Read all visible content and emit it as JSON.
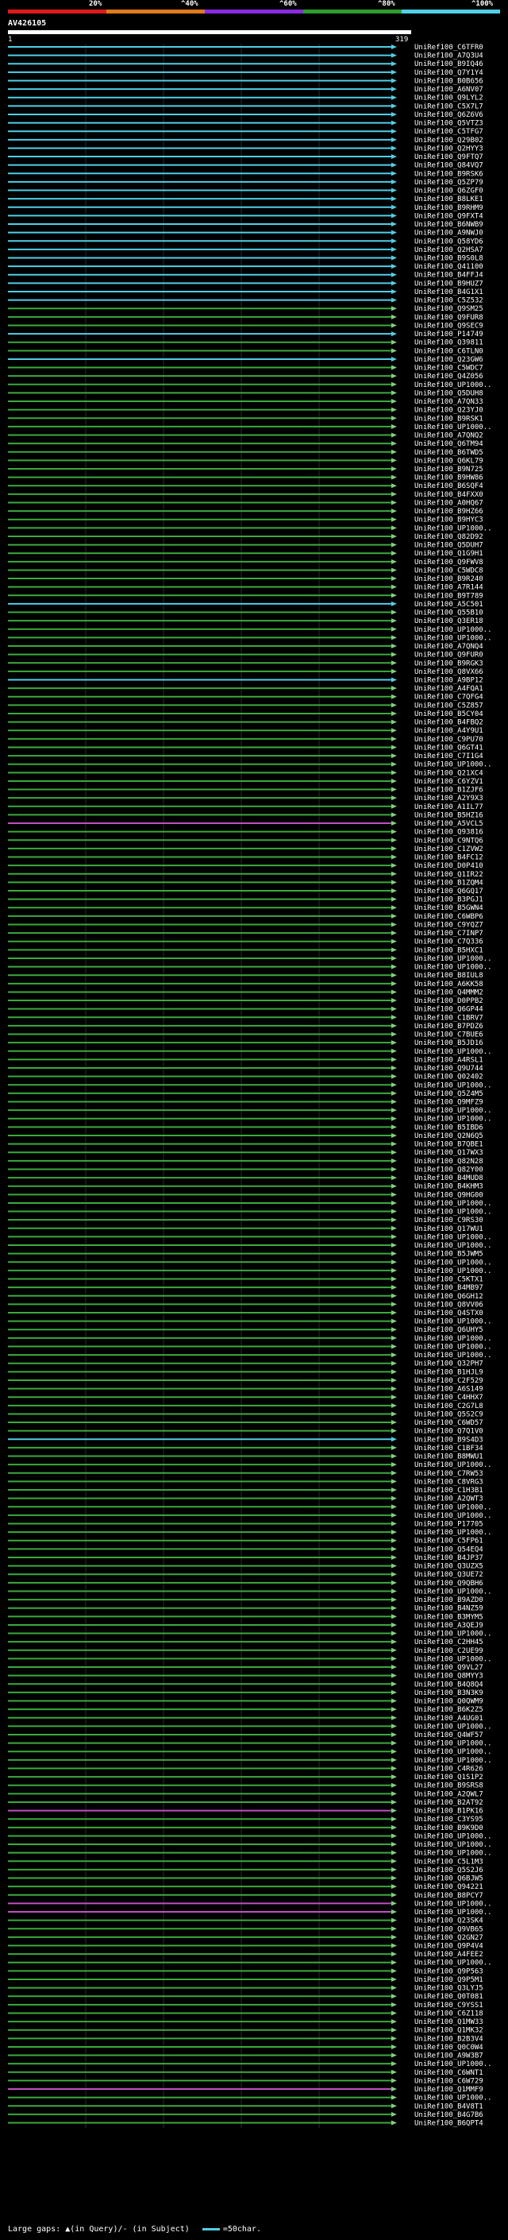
{
  "query": {
    "id": "AV426105",
    "start": "1",
    "end": "319"
  },
  "scale": {
    "labels": [
      "20%",
      "^40%",
      "^60%",
      "^80%",
      "^100%"
    ],
    "colors": [
      "#e01a1a",
      "#e07a1a",
      "#8a2be2",
      "#2e9e2e",
      "#4fd0e6"
    ]
  },
  "colors": {
    "cyan": "#4fd0e6",
    "green": "#3caa3c",
    "magenta": "#c050c0",
    "arrow": "#7fd07f",
    "gap": "#ffff66",
    "grid": "#4a4a4a"
  },
  "hits": [
    {
      "label": "UniRef100_C6TFR0",
      "color": "cyan"
    },
    {
      "label": "UniRef100_A7Q3U4",
      "color": "cyan"
    },
    {
      "label": "UniRef100_B9IQ46",
      "color": "cyan"
    },
    {
      "label": "UniRef100_Q7Y1Y4",
      "color": "cyan"
    },
    {
      "label": "UniRef100_B0B656",
      "color": "cyan"
    },
    {
      "label": "UniRef100_A6NV07",
      "color": "cyan"
    },
    {
      "label": "UniRef100_Q9LYL2",
      "color": "cyan"
    },
    {
      "label": "UniRef100_C5X7L7",
      "color": "cyan"
    },
    {
      "label": "UniRef100_Q6Z6V6",
      "color": "cyan"
    },
    {
      "label": "UniRef100_Q5VTZ3",
      "color": "cyan"
    },
    {
      "label": "UniRef100_C5TFG7",
      "color": "cyan"
    },
    {
      "label": "UniRef100_Q29B02",
      "color": "cyan"
    },
    {
      "label": "UniRef100_Q2HYY3",
      "color": "cyan"
    },
    {
      "label": "UniRef100_Q9FTQ7",
      "color": "cyan"
    },
    {
      "label": "UniRef100_Q84VQ7",
      "color": "cyan"
    },
    {
      "label": "UniRef100_B9RSK6",
      "color": "cyan"
    },
    {
      "label": "UniRef100_Q5ZP79",
      "color": "cyan"
    },
    {
      "label": "UniRef100_Q6ZGF0",
      "color": "cyan"
    },
    {
      "label": "UniRef100_B8LKE1",
      "color": "cyan"
    },
    {
      "label": "UniRef100_B9RHM9",
      "color": "cyan"
    },
    {
      "label": "UniRef100_Q9FXT4",
      "color": "cyan"
    },
    {
      "label": "UniRef100_B6NWB9",
      "color": "cyan"
    },
    {
      "label": "UniRef100_A9NWJ0",
      "color": "cyan"
    },
    {
      "label": "UniRef100_Q58YD6",
      "color": "cyan"
    },
    {
      "label": "UniRef100_Q2HSA7",
      "color": "cyan"
    },
    {
      "label": "UniRef100_B9S0L8",
      "color": "cyan"
    },
    {
      "label": "UniRef100_Q41100",
      "color": "cyan"
    },
    {
      "label": "UniRef100_B4FFJ4",
      "color": "cyan"
    },
    {
      "label": "UniRef100_B9HUZ7",
      "color": "cyan"
    },
    {
      "label": "UniRef100_B4G1X1",
      "color": "cyan"
    },
    {
      "label": "UniRef100_C5Z532",
      "color": "cyan"
    },
    {
      "label": "UniRef100_Q9SM25",
      "color": "green"
    },
    {
      "label": "UniRef100_Q9FUR8",
      "color": "green"
    },
    {
      "label": "UniRef100_Q9SEC9",
      "color": "green"
    },
    {
      "label": "UniRef100_P14749",
      "color": "cyan"
    },
    {
      "label": "UniRef100_Q39811",
      "color": "green"
    },
    {
      "label": "UniRef100_C6TLN0",
      "color": "green"
    },
    {
      "label": "UniRef100_Q23GW6",
      "color": "cyan"
    },
    {
      "label": "UniRef100_C5WDC7",
      "color": "green"
    },
    {
      "label": "UniRef100_Q4Z056",
      "color": "green"
    },
    {
      "label": "UniRef100_UP1000..",
      "color": "green"
    },
    {
      "label": "UniRef100_Q5DUH8",
      "color": "green"
    },
    {
      "label": "UniRef100_A7QN33",
      "color": "green"
    },
    {
      "label": "UniRef100_Q23YJ0",
      "color": "green"
    },
    {
      "label": "UniRef100_B9RSK1",
      "color": "green"
    },
    {
      "label": "UniRef100_UP1000..",
      "color": "green"
    },
    {
      "label": "UniRef100_A7QNQ2",
      "color": "green"
    },
    {
      "label": "UniRef100_Q6TM94",
      "color": "green"
    },
    {
      "label": "UniRef100_B6TWD5",
      "color": "green"
    },
    {
      "label": "UniRef100_Q6KL79",
      "color": "green"
    },
    {
      "label": "UniRef100_B9N725",
      "color": "green"
    },
    {
      "label": "UniRef100_B9HW86",
      "color": "green"
    },
    {
      "label": "UniRef100_B6SQF4",
      "color": "green"
    },
    {
      "label": "UniRef100_B4FXX0",
      "color": "green"
    },
    {
      "label": "UniRef100_A0HQ67",
      "color": "green"
    },
    {
      "label": "UniRef100_B9HZ66",
      "color": "green"
    },
    {
      "label": "UniRef100_B9HYC3",
      "color": "green"
    },
    {
      "label": "UniRef100_UP1000..",
      "color": "green"
    },
    {
      "label": "UniRef100_Q82D92",
      "color": "green"
    },
    {
      "label": "UniRef100_Q5DUH7",
      "color": "green"
    },
    {
      "label": "UniRef100_Q1G9H1",
      "color": "green"
    },
    {
      "label": "UniRef100_Q9FWV8",
      "color": "green"
    },
    {
      "label": "UniRef100_C5WDC8",
      "color": "green"
    },
    {
      "label": "UniRef100_B9R240",
      "color": "green"
    },
    {
      "label": "UniRef100_A7R144",
      "color": "green"
    },
    {
      "label": "UniRef100_B9T789",
      "color": "green"
    },
    {
      "label": "UniRef100_A5C501",
      "color": "cyan"
    },
    {
      "label": "UniRef100_Q55B10",
      "color": "green"
    },
    {
      "label": "UniRef100_Q3ER18",
      "color": "green"
    },
    {
      "label": "UniRef100_UP1000..",
      "color": "green"
    },
    {
      "label": "UniRef100_UP1000..",
      "color": "green"
    },
    {
      "label": "UniRef100_A7QNQ4",
      "color": "green"
    },
    {
      "label": "UniRef100_Q9FUR0",
      "color": "green"
    },
    {
      "label": "UniRef100_B9RGK3",
      "color": "green"
    },
    {
      "label": "UniRef100_Q8VX66",
      "color": "green"
    },
    {
      "label": "UniRef100_A9BP12",
      "color": "cyan"
    },
    {
      "label": "UniRef100_A4FQA1",
      "color": "green"
    },
    {
      "label": "UniRef100_C7QFG4",
      "color": "green"
    },
    {
      "label": "UniRef100_C5Z857",
      "color": "green"
    },
    {
      "label": "UniRef100_B5CY04",
      "color": "green"
    },
    {
      "label": "UniRef100_B4FBQ2",
      "color": "green"
    },
    {
      "label": "UniRef100_A4Y9U1",
      "color": "green"
    },
    {
      "label": "UniRef100_C9PU70",
      "color": "green"
    },
    {
      "label": "UniRef100_Q6GT41",
      "color": "green"
    },
    {
      "label": "UniRef100_C7I1G4",
      "color": "green"
    },
    {
      "label": "UniRef100_UP1000..",
      "color": "green"
    },
    {
      "label": "UniRef100_Q21XC4",
      "color": "green"
    },
    {
      "label": "UniRef100_C6YZV1",
      "color": "green"
    },
    {
      "label": "UniRef100_B1ZJF6",
      "color": "green"
    },
    {
      "label": "UniRef100_A2Y9X3",
      "color": "green"
    },
    {
      "label": "UniRef100_A1IL77",
      "color": "green"
    },
    {
      "label": "UniRef100_B5HZ16",
      "color": "green"
    },
    {
      "label": "UniRef100_A5VCL5",
      "color": "magenta"
    },
    {
      "label": "UniRef100_Q93816",
      "color": "green"
    },
    {
      "label": "UniRef100_C9NTQ6",
      "color": "green"
    },
    {
      "label": "UniRef100_C1ZVW2",
      "color": "green"
    },
    {
      "label": "UniRef100_B4FC12",
      "color": "green"
    },
    {
      "label": "UniRef100_D0P410",
      "color": "green"
    },
    {
      "label": "UniRef100_Q1IR22",
      "color": "green"
    },
    {
      "label": "UniRef100_B1ZQM4",
      "color": "green"
    },
    {
      "label": "UniRef100_Q6GQ17",
      "color": "green"
    },
    {
      "label": "UniRef100_B3PGJ1",
      "color": "green"
    },
    {
      "label": "UniRef100_B5GWN4",
      "color": "green"
    },
    {
      "label": "UniRef100_C6WBP6",
      "color": "green"
    },
    {
      "label": "UniRef100_C9YQZ7",
      "color": "green"
    },
    {
      "label": "UniRef100_C7INP7",
      "color": "green"
    },
    {
      "label": "UniRef100_C7Q336",
      "color": "green"
    },
    {
      "label": "UniRef100_B5HXC1",
      "color": "green"
    },
    {
      "label": "UniRef100_UP1000..",
      "color": "green"
    },
    {
      "label": "UniRef100_UP1000..",
      "color": "green"
    },
    {
      "label": "UniRef100_B8IUL8",
      "color": "green"
    },
    {
      "label": "UniRef100_A6KK58",
      "color": "green"
    },
    {
      "label": "UniRef100_Q4MMM2",
      "color": "green"
    },
    {
      "label": "UniRef100_D0PPB2",
      "color": "green"
    },
    {
      "label": "UniRef100_Q6GP44",
      "color": "green"
    },
    {
      "label": "UniRef100_C1BRV7",
      "color": "green"
    },
    {
      "label": "UniRef100_B7PDZ6",
      "color": "green"
    },
    {
      "label": "UniRef100_C7BUE6",
      "color": "green"
    },
    {
      "label": "UniRef100_B5JD16",
      "color": "green"
    },
    {
      "label": "UniRef100_UP1000..",
      "color": "green"
    },
    {
      "label": "UniRef100_A4RSL1",
      "color": "green"
    },
    {
      "label": "UniRef100_Q9U744",
      "color": "green"
    },
    {
      "label": "UniRef100_Q02402",
      "color": "green"
    },
    {
      "label": "UniRef100_UP1000..",
      "color": "green"
    },
    {
      "label": "UniRef100_Q5Z4M5",
      "color": "green"
    },
    {
      "label": "UniRef100_Q9MFZ9",
      "color": "green"
    },
    {
      "label": "UniRef100_UP1000..",
      "color": "green"
    },
    {
      "label": "UniRef100_UP1000..",
      "color": "green"
    },
    {
      "label": "UniRef100_B5IBD6",
      "color": "green"
    },
    {
      "label": "UniRef100_Q2N6Q5",
      "color": "green"
    },
    {
      "label": "UniRef100_B7QBE1",
      "color": "green"
    },
    {
      "label": "UniRef100_Q17WX3",
      "color": "green"
    },
    {
      "label": "UniRef100_Q82N28",
      "color": "green"
    },
    {
      "label": "UniRef100_Q82Y00",
      "color": "green"
    },
    {
      "label": "UniRef100_B4MUD8",
      "color": "green"
    },
    {
      "label": "UniRef100_B4KHM3",
      "color": "green"
    },
    {
      "label": "UniRef100_Q9HG00",
      "color": "green"
    },
    {
      "label": "UniRef100_UP1000..",
      "color": "green"
    },
    {
      "label": "UniRef100_UP1000..",
      "color": "green"
    },
    {
      "label": "UniRef100_C9RS30",
      "color": "green"
    },
    {
      "label": "UniRef100_Q17WU1",
      "color": "green"
    },
    {
      "label": "UniRef100_UP1000..",
      "color": "green"
    },
    {
      "label": "UniRef100_UP1000..",
      "color": "green"
    },
    {
      "label": "UniRef100_B5JWM5",
      "color": "green"
    },
    {
      "label": "UniRef100_UP1000..",
      "color": "green"
    },
    {
      "label": "UniRef100_UP1000..",
      "color": "green"
    },
    {
      "label": "UniRef100_C5KTX1",
      "color": "green"
    },
    {
      "label": "UniRef100_B4MB97",
      "color": "green"
    },
    {
      "label": "UniRef100_Q6GH12",
      "color": "green"
    },
    {
      "label": "UniRef100_Q8VV06",
      "color": "green"
    },
    {
      "label": "UniRef100_Q4STX0",
      "color": "green"
    },
    {
      "label": "UniRef100_UP1000..",
      "color": "green"
    },
    {
      "label": "UniRef100_Q6UHY5",
      "color": "green"
    },
    {
      "label": "UniRef100_UP1000..",
      "color": "green"
    },
    {
      "label": "UniRef100_UP1000..",
      "color": "green"
    },
    {
      "label": "UniRef100_UP1000..",
      "color": "green"
    },
    {
      "label": "UniRef100_Q32PH7",
      "color": "green"
    },
    {
      "label": "UniRef100_B1HJL9",
      "color": "green"
    },
    {
      "label": "UniRef100_C2F529",
      "color": "green"
    },
    {
      "label": "UniRef100_A6S149",
      "color": "green"
    },
    {
      "label": "UniRef100_C4HHX7",
      "color": "green"
    },
    {
      "label": "UniRef100_C2G7L8",
      "color": "green"
    },
    {
      "label": "UniRef100_Q5S2C9",
      "color": "green"
    },
    {
      "label": "UniRef100_C6WD57",
      "color": "green"
    },
    {
      "label": "UniRef100_Q7Q1V0",
      "color": "green"
    },
    {
      "label": "UniRef100_B9S4D3",
      "color": "cyan"
    },
    {
      "label": "UniRef100_C1BF34",
      "color": "green"
    },
    {
      "label": "UniRef100_B8MWU1",
      "color": "green"
    },
    {
      "label": "UniRef100_UP1000..",
      "color": "green"
    },
    {
      "label": "UniRef100_C7RW53",
      "color": "green"
    },
    {
      "label": "UniRef100_C8VRG3",
      "color": "green"
    },
    {
      "label": "UniRef100_C1H3B1",
      "color": "green"
    },
    {
      "label": "UniRef100_A2QWT3",
      "color": "green"
    },
    {
      "label": "UniRef100_UP1000..",
      "color": "green"
    },
    {
      "label": "UniRef100_UP1000..",
      "color": "green"
    },
    {
      "label": "UniRef100_P17705",
      "color": "green"
    },
    {
      "label": "UniRef100_UP1000..",
      "color": "green"
    },
    {
      "label": "UniRef100_C5FP61",
      "color": "green"
    },
    {
      "label": "UniRef100_Q54EQ4",
      "color": "green"
    },
    {
      "label": "UniRef100_B4JP37",
      "color": "green"
    },
    {
      "label": "UniRef100_Q3UZX5",
      "color": "green"
    },
    {
      "label": "UniRef100_Q3UE72",
      "color": "green"
    },
    {
      "label": "UniRef100_Q9QBH6",
      "color": "green"
    },
    {
      "label": "UniRef100_UP1000..",
      "color": "green"
    },
    {
      "label": "UniRef100_B9AZD0",
      "color": "green"
    },
    {
      "label": "UniRef100_B4NZ59",
      "color": "green"
    },
    {
      "label": "UniRef100_B3MYM5",
      "color": "green"
    },
    {
      "label": "UniRef100_A3QEJ9",
      "color": "green"
    },
    {
      "label": "UniRef100_UP1000..",
      "color": "green"
    },
    {
      "label": "UniRef100_C2HH45",
      "color": "green"
    },
    {
      "label": "UniRef100_C2UE99",
      "color": "green"
    },
    {
      "label": "UniRef100_UP1000..",
      "color": "green"
    },
    {
      "label": "UniRef100_Q9VL27",
      "color": "green"
    },
    {
      "label": "UniRef100_Q8MYY3",
      "color": "green"
    },
    {
      "label": "UniRef100_B4Q8Q4",
      "color": "green"
    },
    {
      "label": "UniRef100_B3N3K9",
      "color": "green"
    },
    {
      "label": "UniRef100_Q0QWM9",
      "color": "green"
    },
    {
      "label": "UniRef100_B6K2Z5",
      "color": "green"
    },
    {
      "label": "UniRef100_A4UG01",
      "color": "green"
    },
    {
      "label": "UniRef100_UP1000..",
      "color": "green"
    },
    {
      "label": "UniRef100_Q4WF57",
      "color": "green"
    },
    {
      "label": "UniRef100_UP1000..",
      "color": "green"
    },
    {
      "label": "UniRef100_UP1000..",
      "color": "green"
    },
    {
      "label": "UniRef100_UP1000..",
      "color": "green"
    },
    {
      "label": "UniRef100_C4R626",
      "color": "green"
    },
    {
      "label": "UniRef100_Q1S1P2",
      "color": "green"
    },
    {
      "label": "UniRef100_B9SRS8",
      "color": "green"
    },
    {
      "label": "UniRef100_A2QWL7",
      "color": "green"
    },
    {
      "label": "UniRef100_B2AT92",
      "color": "green"
    },
    {
      "label": "UniRef100_B1PK16",
      "color": "magenta"
    },
    {
      "label": "UniRef100_C3YS95",
      "color": "green"
    },
    {
      "label": "UniRef100_B9K9D0",
      "color": "green"
    },
    {
      "label": "UniRef100_UP1000..",
      "color": "green"
    },
    {
      "label": "UniRef100_UP1000..",
      "color": "green"
    },
    {
      "label": "UniRef100_UP1000..",
      "color": "green"
    },
    {
      "label": "UniRef100_C5L1M3",
      "color": "green"
    },
    {
      "label": "UniRef100_Q5S2J6",
      "color": "green"
    },
    {
      "label": "UniRef100_Q6BJW5",
      "color": "green"
    },
    {
      "label": "UniRef100_Q94221",
      "color": "green"
    },
    {
      "label": "UniRef100_B8PCY7",
      "color": "green"
    },
    {
      "label": "UniRef100_UP1000..",
      "color": "magenta"
    },
    {
      "label": "UniRef100_UP1000..",
      "color": "magenta"
    },
    {
      "label": "UniRef100_Q23SK4",
      "color": "green"
    },
    {
      "label": "UniRef100_Q9VB65",
      "color": "green"
    },
    {
      "label": "UniRef100_Q2GN27",
      "color": "green"
    },
    {
      "label": "UniRef100_Q9P4V4",
      "color": "green"
    },
    {
      "label": "UniRef100_A4FEE2",
      "color": "green"
    },
    {
      "label": "UniRef100_UP1000..",
      "color": "green"
    },
    {
      "label": "UniRef100_Q9P563",
      "color": "green"
    },
    {
      "label": "UniRef100_Q9P5M1",
      "color": "green"
    },
    {
      "label": "UniRef100_Q3LYJ5",
      "color": "green"
    },
    {
      "label": "UniRef100_Q0T081",
      "color": "green"
    },
    {
      "label": "UniRef100_C9YSS1",
      "color": "green"
    },
    {
      "label": "UniRef100_C6Z118",
      "color": "green"
    },
    {
      "label": "UniRef100_Q1MW33",
      "color": "green"
    },
    {
      "label": "UniRef100_Q1MK32",
      "color": "green"
    },
    {
      "label": "UniRef100_B2B3V4",
      "color": "green"
    },
    {
      "label": "UniRef100_Q0C0W4",
      "color": "green"
    },
    {
      "label": "UniRef100_A9W3B7",
      "color": "green"
    },
    {
      "label": "UniRef100_UP1000..",
      "color": "green"
    },
    {
      "label": "UniRef100_C6WNT1",
      "color": "green"
    },
    {
      "label": "UniRef100_C6W729",
      "color": "green"
    },
    {
      "label": "UniRef100_Q1MMF9",
      "color": "magenta"
    },
    {
      "label": "UniRef100_UP1000..",
      "color": "green"
    },
    {
      "label": "UniRef100_B4V8T1",
      "color": "green"
    },
    {
      "label": "UniRef100_B4G7B6",
      "color": "green"
    },
    {
      "label": "UniRef100_B6QPT4",
      "color": "green"
    }
  ],
  "footer": {
    "gap_text": "Large gaps: ▲(in Query)/- (in Subject)",
    "legend_text": "=50char."
  }
}
